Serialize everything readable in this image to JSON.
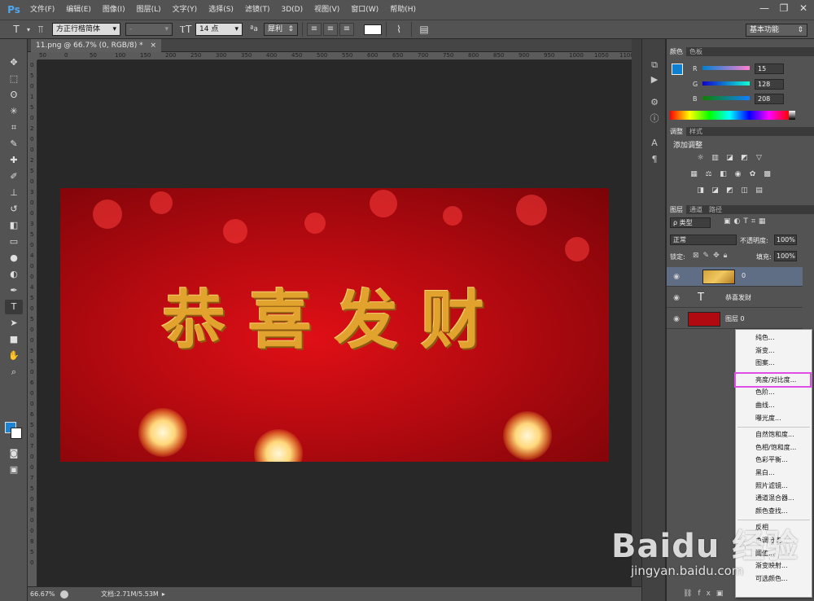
{
  "app": {
    "logo": "Ps"
  },
  "menu": [
    "文件(F)",
    "编辑(E)",
    "图像(I)",
    "图层(L)",
    "文字(Y)",
    "选择(S)",
    "滤镜(T)",
    "3D(D)",
    "视图(V)",
    "窗口(W)",
    "帮助(H)"
  ],
  "window_controls": {
    "minimize": "—",
    "restore": "❐",
    "close": "✕"
  },
  "options": {
    "font_family": "方正行楷简体",
    "font_style": "-",
    "font_size": "14 点",
    "aa_label": "ªa",
    "antialias": "犀利",
    "workspace": "基本功能"
  },
  "document": {
    "tab": "11.png @ 66.7% (0, RGB/8) *",
    "tab_close": "×",
    "art_text": "恭喜发财",
    "zoom": "66.67%",
    "info": "文档:2.71M/5.53M"
  },
  "ruler_h": [
    "50",
    "0",
    "50",
    "100",
    "150",
    "200",
    "250",
    "300",
    "350",
    "400",
    "450",
    "500",
    "550",
    "600",
    "650",
    "700",
    "750",
    "800",
    "850",
    "900",
    "950",
    "1000",
    "1050",
    "1100"
  ],
  "ruler_v": [
    "0",
    "5",
    "0",
    "1",
    "5",
    "0",
    "2",
    "0",
    "0",
    "2",
    "5",
    "0",
    "3",
    "0",
    "0",
    "3",
    "5",
    "0",
    "4",
    "0",
    "0",
    "4",
    "5",
    "0",
    "5",
    "0",
    "0",
    "5",
    "5",
    "0",
    "6",
    "0",
    "0",
    "6",
    "5",
    "0",
    "7",
    "0",
    "0",
    "7",
    "5",
    "0",
    "8",
    "0",
    "0",
    "8",
    "5",
    "0"
  ],
  "color_panel": {
    "tabs": [
      "颜色",
      "色板"
    ],
    "r_label": "R",
    "r": "15",
    "g_label": "G",
    "g": "128",
    "b_label": "B",
    "b": "208",
    "fg": "#0f80d0"
  },
  "adjust_panel": {
    "tabs": [
      "调整",
      "样式"
    ],
    "title": "添加调整"
  },
  "layers_panel": {
    "tabs": [
      "图层",
      "通道",
      "路径"
    ],
    "filter": "ρ 类型",
    "blend": "正常",
    "opacity_label": "不透明度:",
    "opacity": "100%",
    "lock_label": "锁定:",
    "fill_label": "填充:",
    "fill": "100%",
    "layers": [
      {
        "name": "0",
        "type": "image",
        "selected": true
      },
      {
        "name": "恭喜发财",
        "type": "text",
        "selected": false
      },
      {
        "name": "图层 0",
        "type": "image",
        "selected": false
      }
    ]
  },
  "context_menu": {
    "items": [
      "纯色...",
      "渐变...",
      "图案...",
      "亮度/对比度...",
      "色阶...",
      "曲线...",
      "曝光度...",
      "自然饱和度...",
      "色相/饱和度...",
      "色彩平衡...",
      "黑白...",
      "照片滤镜...",
      "通道混合器...",
      "颜色查找...",
      "反相",
      "色调分离...",
      "阈值...",
      "渐变映射...",
      "可选颜色..."
    ],
    "highlighted": "亮度/对比度..."
  },
  "watermark": {
    "main": "Baidu 经验",
    "url": "jingyan.baidu.com"
  },
  "colors": {
    "accent": "#e04ee8",
    "panel": "#535353",
    "canvas_bg": "#282828",
    "art_red": "#c80a12",
    "gold": "#e2a22e"
  }
}
